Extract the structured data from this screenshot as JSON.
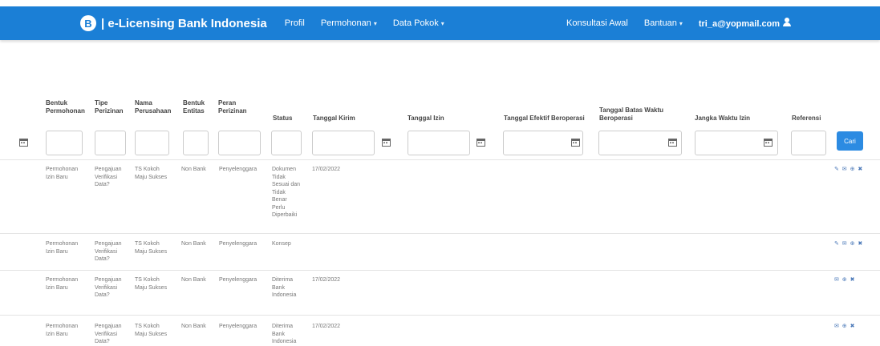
{
  "navbar": {
    "logo": "B",
    "brand": "| e-Licensing Bank Indonesia",
    "items": [
      "Profil",
      "Permohonan",
      "Data Pokok"
    ],
    "right_items": [
      "Konsultasi Awal",
      "Bantuan"
    ],
    "user": "tri_a@yopmail.com"
  },
  "table": {
    "headers": [
      "Bentuk Permohonan",
      "Tipe Perizinan",
      "Nama Perusahaan",
      "Bentuk Entitas",
      "Peran Perizinan",
      "Status",
      "Tanggal Kirim",
      "Tanggal Izin",
      "Tanggal Efektif Beroperasi",
      "Tanggal Batas Waktu Beroperasi",
      "Jangka Waktu Izin",
      "Referensi"
    ],
    "search_button": "Cari",
    "rows": [
      {
        "bentuk": "Permohonan Izin Baru",
        "tipe": "Pengajuan Verifikasi Data?",
        "nama": "TS Kokoh Maju Sukses",
        "entitas": "Non Bank",
        "peran": "Penyelenggara",
        "status": "Dokumen Tidak Sesuai dan Tidak Benar Perlu Diperbaiki",
        "tanggal_kirim": "17/02/2022",
        "actions": "✎ ✉ ⊕ ✖"
      },
      {
        "bentuk": "Permohonan Izin Baru",
        "tipe": "Pengajuan Verifikasi Data?",
        "nama": "TS Kokoh Maju Sukses",
        "entitas": "Non Bank",
        "peran": "Penyelenggara",
        "status": "Konsep",
        "tanggal_kirim": "",
        "actions": "✎ ✉ ⊕ ✖"
      },
      {
        "bentuk": "Permohonan Izin Baru",
        "tipe": "Pengajuan Verifikasi Data?",
        "nama": "TS Kokoh Maju Sukses",
        "entitas": "Non Bank",
        "peran": "Penyelenggara",
        "status": "Diterima Bank Indonesia",
        "tanggal_kirim": "17/02/2022",
        "actions": "✉ ⊕ ✖"
      },
      {
        "bentuk": "Permohonan Izin Baru",
        "tipe": "Pengajuan Verifikasi Data?",
        "nama": "TS Kokoh Maju Sukses",
        "entitas": "Non Bank",
        "peran": "Penyelenggara",
        "status": "Diterima Bank Indonesia",
        "tanggal_kirim": "17/02/2022",
        "actions": "✉ ⊕ ✖"
      }
    ]
  }
}
